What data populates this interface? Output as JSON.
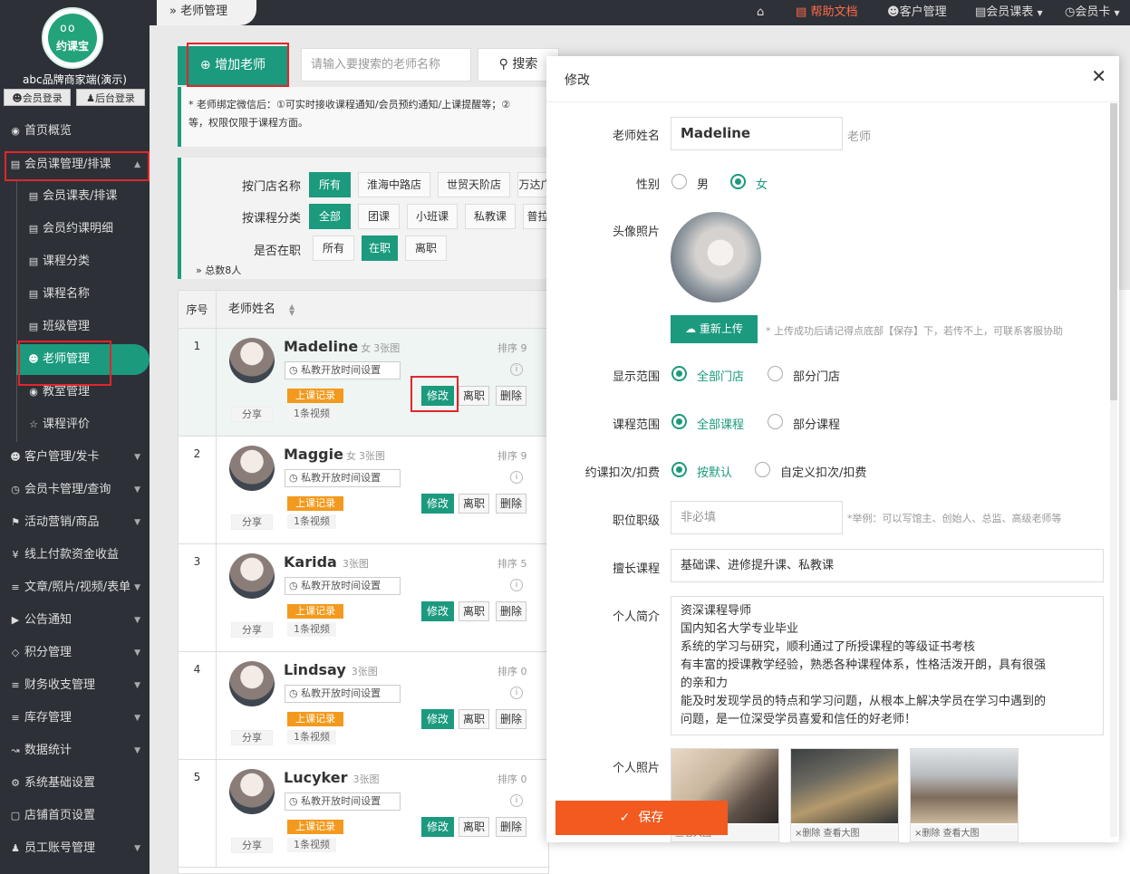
{
  "sidebar": {
    "logo_text": "约课宝",
    "brand": "abc品牌商家端(演示)",
    "member_login": "会员登录",
    "admin_login": "后台登录",
    "items": [
      {
        "label": "首页概览"
      },
      {
        "label": "会员课管理/排课"
      },
      {
        "label": "客户管理/发卡"
      },
      {
        "label": "会员卡管理/查询"
      },
      {
        "label": "活动营销/商品"
      },
      {
        "label": "线上付款资金收益"
      },
      {
        "label": "文章/照片/视频/表单"
      },
      {
        "label": "公告通知"
      },
      {
        "label": "积分管理"
      },
      {
        "label": "财务收支管理"
      },
      {
        "label": "库存管理"
      },
      {
        "label": "数据统计"
      },
      {
        "label": "系统基础设置"
      },
      {
        "label": "店铺首页设置"
      },
      {
        "label": "员工账号管理"
      }
    ],
    "sub_items": [
      {
        "label": "会员课表/排课"
      },
      {
        "label": "会员约课明细"
      },
      {
        "label": "课程分类"
      },
      {
        "label": "课程名称"
      },
      {
        "label": "班级管理"
      },
      {
        "label": "老师管理"
      },
      {
        "label": "教室管理"
      },
      {
        "label": "课程评价"
      }
    ]
  },
  "topbar": {
    "breadcrumb": "老师管理",
    "help": "帮助文档",
    "customer": "客户管理",
    "schedule": "会员课表",
    "card": "会员卡"
  },
  "toolbar": {
    "add_label": "增加老师",
    "search_placeholder": "请输入要搜索的老师名称",
    "search_label": "搜索"
  },
  "notice": {
    "line1": "* 老师绑定微信后：①可实时接收课程通知/会员预约通知/上课提醒等；②",
    "line2": "等，权限仅限于课程方面。"
  },
  "filters": {
    "store_label": "按门店名称",
    "stores": [
      "所有",
      "淮海中路店",
      "世贸天阶店",
      "万达广"
    ],
    "cat_label": "按课程分类",
    "cats": [
      "全部",
      "团课",
      "小班课",
      "私教课",
      "普拉"
    ],
    "status_label": "是否在职",
    "statuses": [
      "所有",
      "在职",
      "离职"
    ],
    "total": "总数8人"
  },
  "table": {
    "col_seq": "序号",
    "col_name": "老师姓名",
    "time_btn": "私教开放时间设置",
    "record": "上课记录",
    "share": "分享",
    "videos": "1条视频",
    "edit": "修改",
    "leave": "离职",
    "del": "删除",
    "rows": [
      {
        "seq": "1",
        "name": "Madeline",
        "gender": "女",
        "pics": "3张图",
        "rank": "排序 9"
      },
      {
        "seq": "2",
        "name": "Maggie",
        "gender": "女",
        "pics": "3张图",
        "rank": "排序 9"
      },
      {
        "seq": "3",
        "name": "Karida",
        "gender": "",
        "pics": "3张图",
        "rank": "排序 5"
      },
      {
        "seq": "4",
        "name": "Lindsay",
        "gender": "",
        "pics": "3张图",
        "rank": "排序 0"
      },
      {
        "seq": "5",
        "name": "Lucyker",
        "gender": "",
        "pics": "3张图",
        "rank": "排序 0"
      }
    ]
  },
  "modal": {
    "title": "修改",
    "name_label": "老师姓名",
    "name_value": "Madeline",
    "name_suffix": "老师",
    "gender_label": "性别",
    "gender_male": "男",
    "gender_female": "女",
    "photo_label": "头像照片",
    "reupload": "重新上传",
    "upload_hint": "* 上传成功后请记得点底部【保存】下，若传不上，可联系客服协助",
    "scope_label": "显示范围",
    "scope_all": "全部门店",
    "scope_part": "部分门店",
    "course_label": "课程范围",
    "course_all": "全部课程",
    "course_part": "部分课程",
    "deduct_label": "约课扣次/扣费",
    "deduct_default": "按默认",
    "deduct_custom": "自定义扣次/扣费",
    "title_label": "职位职级",
    "title_placeholder": "非必填",
    "title_hint": "*举例：可以写馆主、创始人、总监、高级老师等",
    "skill_label": "擅长课程",
    "skill_value": "基础课、进修提升课、私教课",
    "bio_label": "个人简介",
    "bio_lines": [
      "资深课程导师",
      "国内知名大学专业毕业",
      "系统的学习与研究，顺利通过了所授课程的等级证书考核",
      "有丰富的授课教学经验，熟悉各种课程体系，性格活泼开朗，具有很强",
      "的亲和力",
      "能及时发现学员的特点和学习问题，从根本上解决学员在学习中遇到的",
      "问题，是一位深受学员喜爱和信任的好老师！"
    ],
    "photos_label": "个人照片",
    "photo_caption_1": "查看大图",
    "photo_caption_2": "×删除  查看大图",
    "save": "保存"
  },
  "colors": {
    "accent": "#1b9a7e",
    "save": "#f25a1f",
    "record": "#f39a1e",
    "highlight": "#e1262a",
    "sidebar": "#2d3137"
  }
}
